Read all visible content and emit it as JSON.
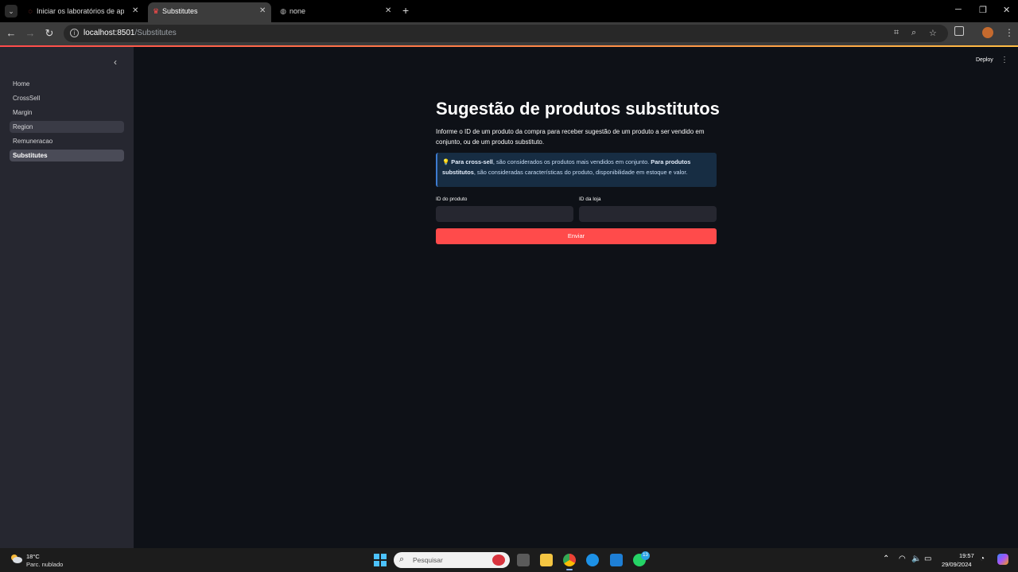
{
  "browser": {
    "tabs": [
      {
        "label": "Iniciar os laboratórios de aprendizado",
        "icon": "spinner-icon",
        "active": false
      },
      {
        "label": "Substitutes",
        "icon": "streamlit-icon",
        "active": true
      },
      {
        "label": "none",
        "icon": "globe-icon",
        "active": false
      }
    ],
    "new_tab_symbol": "+",
    "url_host": "localhost:8501",
    "url_path": "/Substitutes"
  },
  "sidebar": {
    "items": [
      {
        "label": "Home",
        "state": "normal"
      },
      {
        "label": "CrossSell",
        "state": "normal"
      },
      {
        "label": "Margin",
        "state": "normal"
      },
      {
        "label": "Region",
        "state": "hover"
      },
      {
        "label": "Remuneracao",
        "state": "normal"
      },
      {
        "label": "Substitutes",
        "state": "active"
      }
    ]
  },
  "header": {
    "deploy_label": "Deploy"
  },
  "main": {
    "title": "Sugestão de produtos substitutos",
    "description": "Informe o ID de um produto da compra para receber sugestão de um produto a ser vendido em conjunto, ou de um produto substituto.",
    "info": {
      "bold1": "Para cross-sell",
      "text1": ", são considerados os produtos mais vendidos em conjunto. ",
      "bold2": "Para produtos substitutos",
      "text2": ", são consideradas características do produto, disponibilidade em estoque e valor."
    },
    "product_id_label": "ID do produto",
    "product_id_value": "",
    "store_id_label": "ID da loja",
    "store_id_value": "",
    "submit_label": "Enviar"
  },
  "taskbar": {
    "temperature": "18°C",
    "weather": "Parc. nublado",
    "search_placeholder": "Pesquisar",
    "whatsapp_badge": "13",
    "time": "19:57",
    "date": "29/09/2024"
  },
  "colors": {
    "accent": "#ff4b4b",
    "background": "#0e1117",
    "sidebar": "#262730",
    "info_bg": "#172d43"
  }
}
